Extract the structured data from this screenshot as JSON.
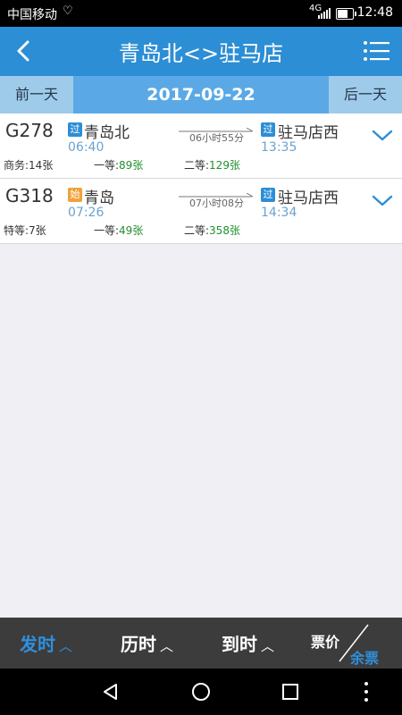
{
  "status": {
    "carrier": "中国移动",
    "network": "4G",
    "time": "12:48",
    "heart_icon": "heart-pulse-icon"
  },
  "header": {
    "title": "青岛北<>驻马店",
    "back_icon": "back-chevron-icon",
    "menu_icon": "menu-list-icon"
  },
  "datebar": {
    "prev": "前一天",
    "date": "2017-09-22",
    "next": "后一天"
  },
  "trains": [
    {
      "code": "G278",
      "dep_badge": "过",
      "dep_badge_color": "#2c8ed4",
      "dep_station": "青岛北",
      "dep_time": "06:40",
      "duration": "06小时55分",
      "arr_badge": "过",
      "arr_station": "驻马店西",
      "arr_time": "13:35",
      "seats": [
        {
          "label": "商务:",
          "count": "14张"
        },
        {
          "label": "一等:",
          "count": "89张"
        },
        {
          "label": "二等:",
          "count": "129张"
        }
      ]
    },
    {
      "code": "G318",
      "dep_badge": "始",
      "dep_badge_color": "#f0a23a",
      "dep_station": "青岛",
      "dep_time": "07:26",
      "duration": "07小时08分",
      "arr_badge": "过",
      "arr_station": "驻马店西",
      "arr_time": "14:34",
      "seats": [
        {
          "label": "特等:",
          "count": "7张"
        },
        {
          "label": "一等:",
          "count": "49张"
        },
        {
          "label": "二等:",
          "count": "358张"
        }
      ]
    }
  ],
  "bottombar": {
    "dep_label": "发时",
    "dur_label": "历时",
    "arr_label": "到时",
    "price_label": "票价",
    "remain_label": "余票",
    "caret": "︿"
  },
  "colors": {
    "header": "#2c8ed4",
    "accent": "#2f90dd",
    "seat_count": "#1f8f2c"
  }
}
